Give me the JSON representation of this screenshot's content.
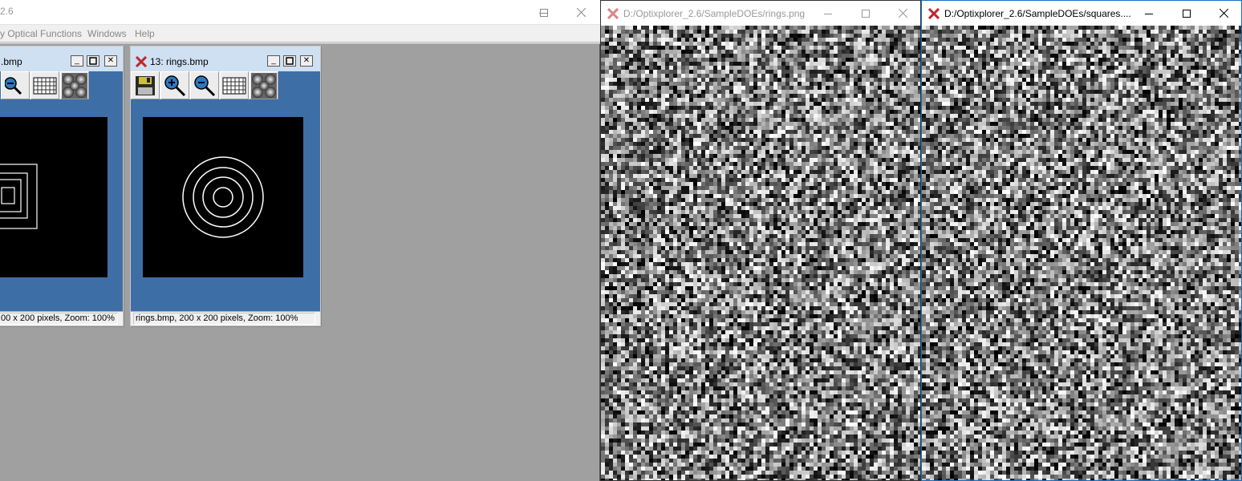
{
  "main_window": {
    "title": "2.6",
    "menu": [
      "y Optical Functions",
      "Windows",
      "Help"
    ],
    "children": [
      {
        "title": ".bmp",
        "status": "00 x 200 pixels, Zoom: 100%"
      },
      {
        "title": "13: rings.bmp",
        "status": "rings.bmp, 200 x 200 pixels, Zoom: 100%"
      }
    ]
  },
  "rings_window": {
    "title": "D:/Optixplorer_2.6/SampleDOEs/rings.png"
  },
  "squares_window": {
    "title": "D:/Optixplorer_2.6/SampleDOEs/squares...."
  },
  "icons": {
    "save": "floppy-disk-icon",
    "zoom_in": "zoom-in-icon",
    "zoom_out": "zoom-out-icon",
    "grid": "grid-icon",
    "phase": "phase-pattern-icon",
    "app_logo": "optixplorer-x-icon"
  },
  "colors": {
    "mdi_background": "#a0a0a0",
    "child_body": "#3e6ea6",
    "logo_red": "#c0272d"
  }
}
